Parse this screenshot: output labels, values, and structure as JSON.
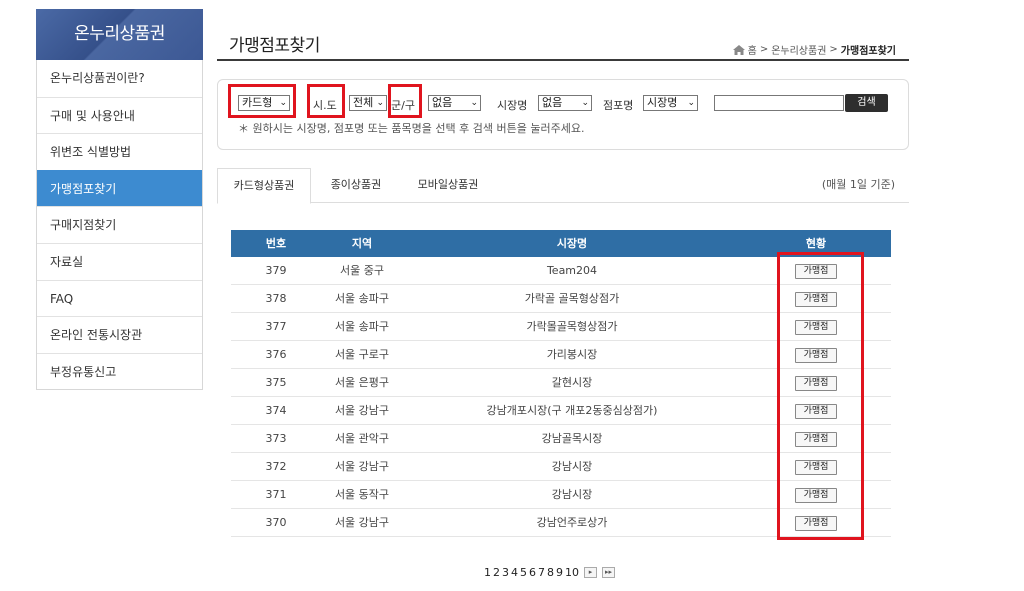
{
  "sidebar": {
    "title": "온누리상품권",
    "items": [
      {
        "label": "온누리상품권이란?"
      },
      {
        "label": "구매 및 사용안내"
      },
      {
        "label": "위변조 식별방법"
      },
      {
        "label": "가맹점포찾기"
      },
      {
        "label": "구매지점찾기"
      },
      {
        "label": "자료실"
      },
      {
        "label": "FAQ"
      },
      {
        "label": "온라인 전통시장관"
      },
      {
        "label": "부정유통신고"
      }
    ]
  },
  "page": {
    "title": "가맹점포찾기",
    "breadcrumb": [
      "홈",
      "온누리상품권",
      "가맹점포찾기"
    ]
  },
  "search": {
    "type_select": "카드형",
    "sido_label": "시.도",
    "sido_select": "전체",
    "gungu_label": "군/구",
    "gungu_select": "없음",
    "market_label": "시장명",
    "market_select": "없음",
    "store_label": "점포명",
    "store_select": "시장명",
    "input_value": "",
    "button": "검색",
    "hint": "＊ 원하시는 시장명, 점포명 또는 품목명을 선택 후 검색 버튼을 눌러주세요."
  },
  "tabs": {
    "items": [
      {
        "label": "카드형상품권"
      },
      {
        "label": "종이상품권"
      },
      {
        "label": "모바일상품권"
      }
    ],
    "note": "(매월 1일 기준)"
  },
  "table": {
    "headers": [
      "번호",
      "지역",
      "시장명",
      "현황"
    ],
    "button_label": "가맹점",
    "rows": [
      {
        "no": "379",
        "region": "서울 중구",
        "market": "Team204"
      },
      {
        "no": "378",
        "region": "서울 송파구",
        "market": "가락골 골목형상점가"
      },
      {
        "no": "377",
        "region": "서울 송파구",
        "market": "가락몰골목형상점가"
      },
      {
        "no": "376",
        "region": "서울 구로구",
        "market": "가리봉시장"
      },
      {
        "no": "375",
        "region": "서울 은평구",
        "market": "갈현시장"
      },
      {
        "no": "374",
        "region": "서울 강남구",
        "market": "강남개포시장(구 개포2동중심상점가)"
      },
      {
        "no": "373",
        "region": "서울 관악구",
        "market": "강남골목시장"
      },
      {
        "no": "372",
        "region": "서울 강남구",
        "market": "강남시장"
      },
      {
        "no": "371",
        "region": "서울 동작구",
        "market": "강남시장"
      },
      {
        "no": "370",
        "region": "서울 강남구",
        "market": "강남언주로상가"
      }
    ]
  },
  "pagination": {
    "pages": [
      "1",
      "2",
      "3",
      "4",
      "5",
      "6",
      "7",
      "8",
      "9",
      "10"
    ],
    "next": "▸",
    "last": "▸▸"
  },
  "colors": {
    "accent": "#3d8bd0",
    "table_header": "#2f6ea5",
    "highlight": "#e0141e"
  }
}
